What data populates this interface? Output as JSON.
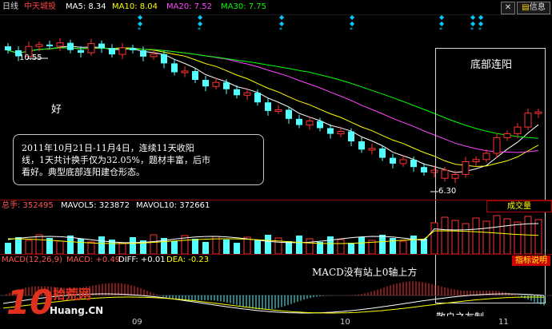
{
  "topbar": {
    "period": "日线",
    "stock_name": "中天城投",
    "ma": [
      {
        "label": "MA5: 8.34",
        "color": "#ffffff"
      },
      {
        "label": "MA10: 8.04",
        "color": "#ffff00"
      },
      {
        "label": "MA20: 7.52",
        "color": "#ff44ff"
      },
      {
        "label": "MA30: 7.75",
        "color": "#00ff00"
      }
    ],
    "buttons": {
      "info_label": "信息"
    }
  },
  "main_chart": {
    "price_high_label": "10.55",
    "price_low_label": "6.30",
    "annotation_good": "好",
    "highlight_title": "底部连阳",
    "note_lines": [
      "2011年10月21日-11月4日，连续11天收阳",
      "线，1天共计换手仅为32.05%，题材丰富，后市",
      "看好。典型底部连阳建仓形态。"
    ]
  },
  "volume_panel": {
    "labels": [
      {
        "label": "总手: 352495",
        "color": "#ff5555"
      },
      {
        "label": "MAVOL5: 323872",
        "color": "#ffffff"
      },
      {
        "label": "MAVOL10: 372661",
        "color": "#ffffff"
      }
    ],
    "badge": "成交量"
  },
  "macd_panel": {
    "labels": [
      {
        "label": "MACD(12,26,9)",
        "color": "#ff5555"
      },
      {
        "label": "MACD: +0.49",
        "color": "#ff5555"
      },
      {
        "label": "DIFF: +0.01",
        "color": "#ffffff"
      },
      {
        "label": "DEA: -0.23",
        "color": "#ffff00"
      }
    ],
    "badge": "指标说明",
    "annotation": "MACD没有站上0轴上方",
    "footer_text": "散户之友制"
  },
  "x_axis": {
    "ticks": [
      "09",
      "10",
      "11"
    ]
  },
  "watermark": {
    "logo": "10",
    "cn_name": "拾荒网",
    "url": "Huang.CN"
  },
  "colors": {
    "up_red": "#ff3232",
    "down_cyan": "#54ffff",
    "ma5_white": "#ffffff",
    "ma10_yellow": "#ffff00",
    "ma20_magenta": "#ff44ff",
    "ma30_green": "#00ff00",
    "signal_cyan": "#00ccff"
  },
  "icons": [
    "close-icon",
    "info-icon",
    "signal-marker-icon"
  ]
}
